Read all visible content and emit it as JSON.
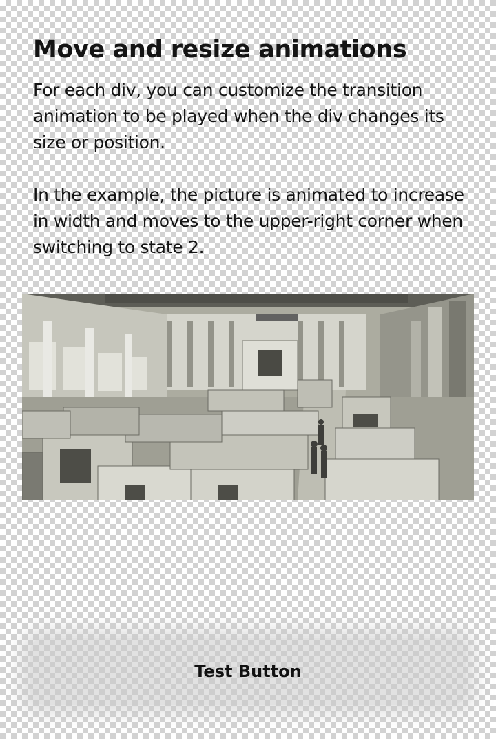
{
  "header": {
    "title": "Move and resize animations"
  },
  "content": {
    "paragraphs": [
      "For each div, you can customize the transition animation to be played when the div changes its size or position.",
      "In the example, the picture is animated to increase in width and moves to the upper-right corner when switching to state 2."
    ]
  },
  "image": {
    "subject": "factory-hall-with-prefabricated-modules",
    "tint": "#c9c8bb"
  },
  "actions": {
    "test_button_label": "Test Button"
  },
  "colors": {
    "text": "#141414",
    "checker_dark": "#d2d2d2",
    "checker_light": "#ffffff"
  }
}
